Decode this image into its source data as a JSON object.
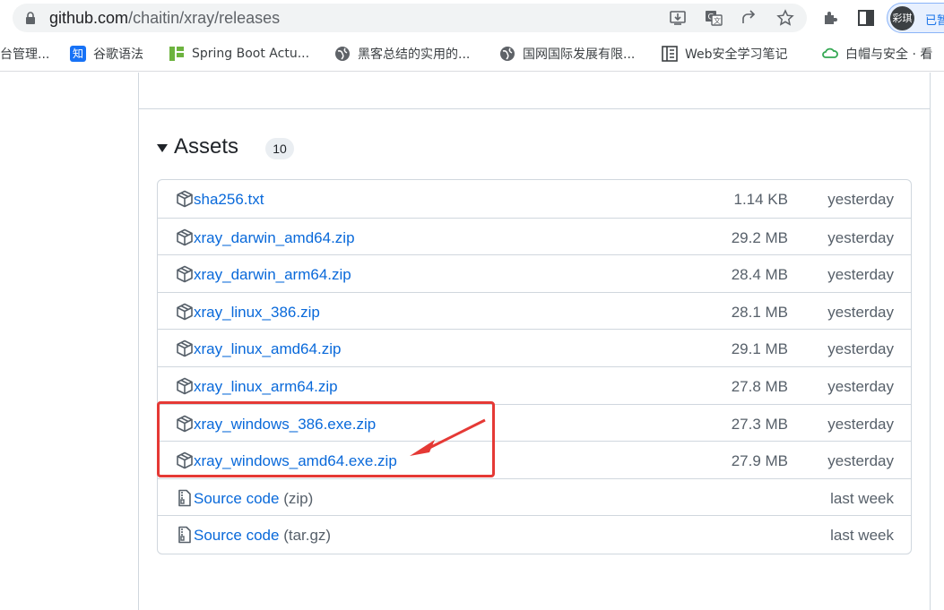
{
  "browser": {
    "url_host": "github.com",
    "url_path": "/chaitin/xray/releases",
    "profile_initials": "彩琪",
    "profile_label": "已暂"
  },
  "bookmarks": [
    {
      "label": "台管理...",
      "icon": "cropped-icon"
    },
    {
      "label": "谷歌语法",
      "icon": "zhihu-icon"
    },
    {
      "label": "Spring Boot Actu...",
      "icon": "spring-icon"
    },
    {
      "label": "黑客总结的实用的...",
      "icon": "globe-icon"
    },
    {
      "label": "国网国际发展有限...",
      "icon": "globe-icon"
    },
    {
      "label": "Web安全学习笔记",
      "icon": "book-icon"
    },
    {
      "label": "白帽与安全 · 看",
      "icon": "cloud-icon"
    }
  ],
  "assets": {
    "title": "Assets",
    "count": "10",
    "items": [
      {
        "name": "sha256.txt",
        "size": "1.14 KB",
        "date": "yesterday",
        "icon": "package-icon"
      },
      {
        "name": "xray_darwin_amd64.zip",
        "size": "29.2 MB",
        "date": "yesterday",
        "icon": "package-icon"
      },
      {
        "name": "xray_darwin_arm64.zip",
        "size": "28.4 MB",
        "date": "yesterday",
        "icon": "package-icon"
      },
      {
        "name": "xray_linux_386.zip",
        "size": "28.1 MB",
        "date": "yesterday",
        "icon": "package-icon"
      },
      {
        "name": "xray_linux_amd64.zip",
        "size": "29.1 MB",
        "date": "yesterday",
        "icon": "package-icon"
      },
      {
        "name": "xray_linux_arm64.zip",
        "size": "27.8 MB",
        "date": "yesterday",
        "icon": "package-icon"
      },
      {
        "name": "xray_windows_386.exe.zip",
        "size": "27.3 MB",
        "date": "yesterday",
        "icon": "package-icon"
      },
      {
        "name": "xray_windows_amd64.exe.zip",
        "size": "27.9 MB",
        "date": "yesterday",
        "icon": "package-icon"
      },
      {
        "name": "Source code",
        "suffix": "(zip)",
        "size": "",
        "date": "last week",
        "icon": "file-zip-icon"
      },
      {
        "name": "Source code",
        "suffix": "(tar.gz)",
        "size": "",
        "date": "last week",
        "icon": "file-zip-icon"
      }
    ]
  },
  "colors": {
    "link": "#0969da",
    "muted": "#57606a",
    "highlight": "#e53935"
  }
}
